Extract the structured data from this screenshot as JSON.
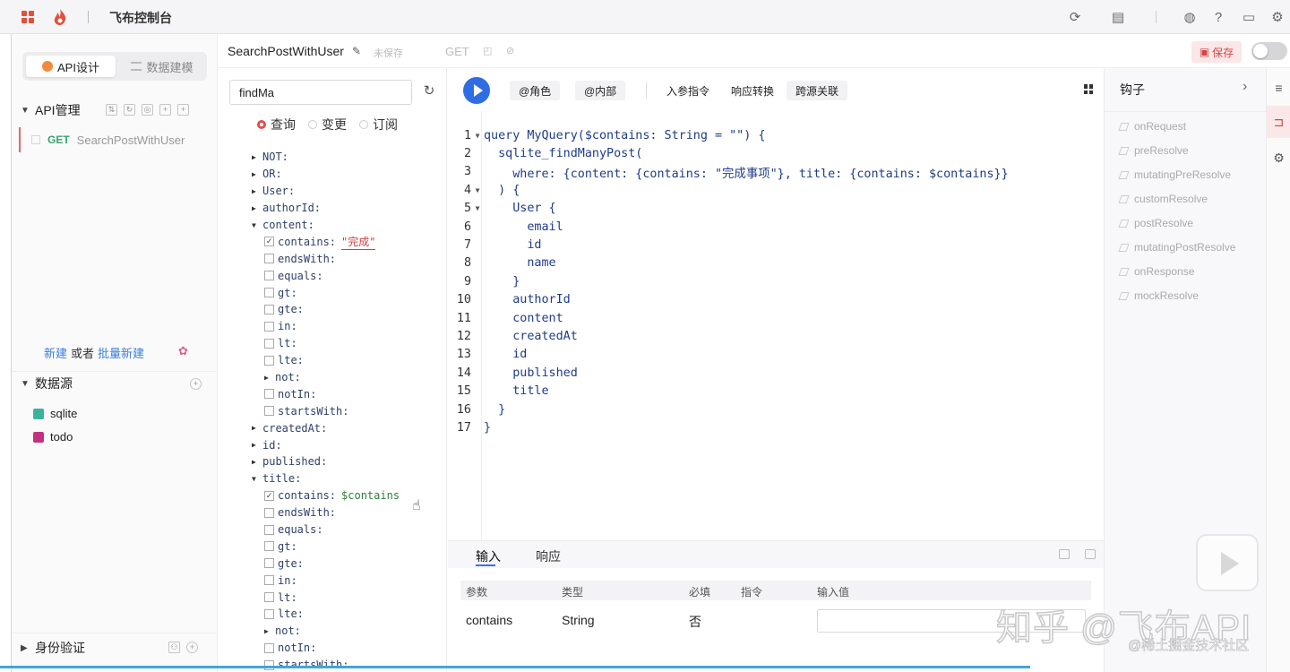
{
  "topbar": {
    "title": "飞布控制台",
    "icons": [
      "apps-icon",
      "flame-logo-icon",
      "sync-icon",
      "document-check-icon",
      "github-icon",
      "help-icon",
      "chat-icon",
      "settings-icon"
    ]
  },
  "sidebar": {
    "tabs": [
      {
        "label": "API设计",
        "active": true
      },
      {
        "label": "数据建模",
        "active": false
      }
    ],
    "api_section": {
      "label": "API管理",
      "items": [
        {
          "method": "GET",
          "name": "SearchPostWithUser"
        }
      ]
    },
    "new_line": {
      "new_label": "新建",
      "or_label": "或者",
      "batch_label": "批量新建"
    },
    "datasource_section": {
      "label": "数据源",
      "items": [
        {
          "name": "sqlite",
          "color": "#3bb39b"
        },
        {
          "name": "todo",
          "color": "#c2307f"
        }
      ]
    },
    "auth_section": {
      "label": "身份验证"
    }
  },
  "editor_header": {
    "operation_name": "SearchPostWithUser",
    "unsaved": "未保存",
    "method": "GET",
    "save_label": "保存"
  },
  "explorer": {
    "search_value": "findMa",
    "operation_types": [
      {
        "label": "查询",
        "selected": true
      },
      {
        "label": "变更",
        "selected": false
      },
      {
        "label": "订阅",
        "selected": false
      }
    ],
    "tree": [
      {
        "depth": 0,
        "kind": "arrow",
        "open": false,
        "label": "NOT:"
      },
      {
        "depth": 0,
        "kind": "arrow",
        "open": false,
        "label": "OR:"
      },
      {
        "depth": 0,
        "kind": "arrow",
        "open": false,
        "label": "User:"
      },
      {
        "depth": 0,
        "kind": "arrow",
        "open": false,
        "label": "authorId:"
      },
      {
        "depth": 0,
        "kind": "arrow",
        "open": true,
        "label": "content:"
      },
      {
        "depth": 1,
        "kind": "check",
        "checked": true,
        "label": "contains:",
        "value": "\"完成\"",
        "value_type": "string"
      },
      {
        "depth": 1,
        "kind": "check",
        "checked": false,
        "label": "endsWith:"
      },
      {
        "depth": 1,
        "kind": "check",
        "checked": false,
        "label": "equals:"
      },
      {
        "depth": 1,
        "kind": "check",
        "checked": false,
        "label": "gt:"
      },
      {
        "depth": 1,
        "kind": "check",
        "checked": false,
        "label": "gte:"
      },
      {
        "depth": 1,
        "kind": "check",
        "checked": false,
        "label": "in:"
      },
      {
        "depth": 1,
        "kind": "check",
        "checked": false,
        "label": "lt:"
      },
      {
        "depth": 1,
        "kind": "check",
        "checked": false,
        "label": "lte:"
      },
      {
        "depth": 1,
        "kind": "arrow",
        "open": false,
        "label": "not:"
      },
      {
        "depth": 1,
        "kind": "check",
        "checked": false,
        "label": "notIn:"
      },
      {
        "depth": 1,
        "kind": "check",
        "checked": false,
        "label": "startsWith:"
      },
      {
        "depth": 0,
        "kind": "arrow",
        "open": false,
        "label": "createdAt:"
      },
      {
        "depth": 0,
        "kind": "arrow",
        "open": false,
        "label": "id:"
      },
      {
        "depth": 0,
        "kind": "arrow",
        "open": false,
        "label": "published:"
      },
      {
        "depth": 0,
        "kind": "arrow",
        "open": true,
        "label": "title:"
      },
      {
        "depth": 1,
        "kind": "check",
        "checked": true,
        "label": "contains:",
        "value": "$contains",
        "value_type": "variable"
      },
      {
        "depth": 1,
        "kind": "check",
        "checked": false,
        "label": "endsWith:"
      },
      {
        "depth": 1,
        "kind": "check",
        "checked": false,
        "label": "equals:"
      },
      {
        "depth": 1,
        "kind": "check",
        "checked": false,
        "label": "gt:"
      },
      {
        "depth": 1,
        "kind": "check",
        "checked": false,
        "label": "gte:"
      },
      {
        "depth": 1,
        "kind": "check",
        "checked": false,
        "label": "in:"
      },
      {
        "depth": 1,
        "kind": "check",
        "checked": false,
        "label": "lt:"
      },
      {
        "depth": 1,
        "kind": "check",
        "checked": false,
        "label": "lte:"
      },
      {
        "depth": 1,
        "kind": "arrow",
        "open": false,
        "label": "not:"
      },
      {
        "depth": 1,
        "kind": "check",
        "checked": false,
        "label": "notIn:"
      },
      {
        "depth": 1,
        "kind": "check",
        "checked": false,
        "label": "startsWith:"
      }
    ]
  },
  "toolbar": {
    "buttons": [
      "@角色",
      "@内部",
      "入参指令",
      "响应转换",
      "跨源关联"
    ]
  },
  "code": {
    "lines": [
      {
        "n": "1",
        "fold": true,
        "text": "query MyQuery($contains: String = \"\") {"
      },
      {
        "n": "2",
        "fold": false,
        "text": "  sqlite_findManyPost("
      },
      {
        "n": "3",
        "fold": false,
        "text": "    where: {content: {contains: \"完成事项\"}, title: {contains: $contains}}"
      },
      {
        "n": "4",
        "fold": true,
        "text": "  ) {"
      },
      {
        "n": "5",
        "fold": true,
        "text": "    User {"
      },
      {
        "n": "6",
        "fold": false,
        "text": "      email"
      },
      {
        "n": "7",
        "fold": false,
        "text": "      id"
      },
      {
        "n": "8",
        "fold": false,
        "text": "      name"
      },
      {
        "n": "9",
        "fold": false,
        "text": "    }"
      },
      {
        "n": "10",
        "fold": false,
        "text": "    authorId"
      },
      {
        "n": "11",
        "fold": false,
        "text": "    content"
      },
      {
        "n": "12",
        "fold": false,
        "text": "    createdAt"
      },
      {
        "n": "13",
        "fold": false,
        "text": "    id"
      },
      {
        "n": "14",
        "fold": false,
        "text": "    published"
      },
      {
        "n": "15",
        "fold": false,
        "text": "    title"
      },
      {
        "n": "16",
        "fold": false,
        "text": "  }"
      },
      {
        "n": "17",
        "fold": false,
        "text": "}"
      }
    ]
  },
  "bottom_panel": {
    "tabs": [
      {
        "label": "输入",
        "active": true
      },
      {
        "label": "响应",
        "active": false
      }
    ],
    "columns": [
      "参数",
      "类型",
      "必填",
      "指令",
      "输入值"
    ],
    "rows": [
      {
        "param": "contains",
        "type": "String",
        "required": "否",
        "directive": "",
        "value": ""
      }
    ]
  },
  "hooks": {
    "title": "钩子",
    "items": [
      "onRequest",
      "preResolve",
      "mutatingPreResolve",
      "customResolve",
      "postResolve",
      "mutatingPostResolve",
      "onResponse",
      "mockResolve"
    ]
  },
  "watermark": {
    "main": "知乎 @飞布API",
    "sub": "@稀土掘金技术社区"
  },
  "colors": {
    "accent_blue": "#2f6de5",
    "brand_red": "#e0503a",
    "save_bg": "#fbe7e7",
    "method_get": "#39a46c"
  }
}
